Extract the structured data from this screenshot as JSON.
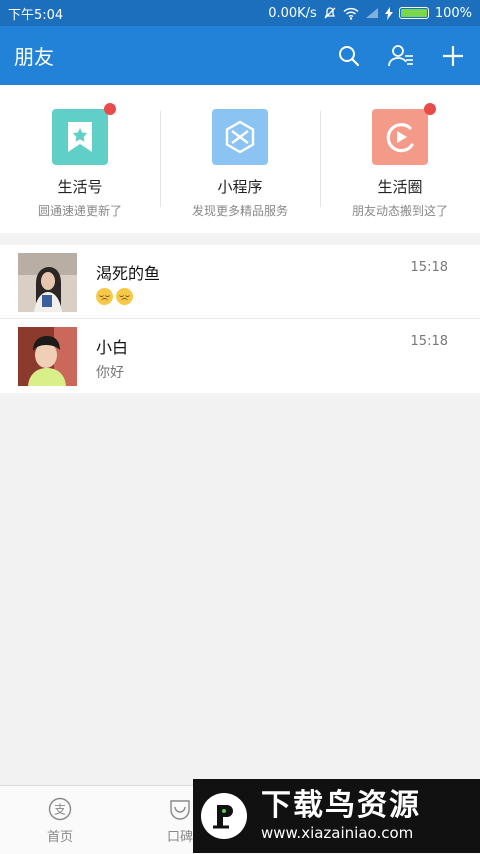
{
  "statusbar": {
    "time": "下午5:04",
    "speed": "0.00K/s",
    "battery": "100%"
  },
  "header": {
    "title": "朋友",
    "icons": [
      "search-icon",
      "contacts-icon",
      "plus-icon"
    ]
  },
  "quick_entries": [
    {
      "label": "生活号",
      "subtitle": "圆通速递更新了",
      "icon": "bookmark-star-icon",
      "color": "#5fcfc7",
      "has_badge": true
    },
    {
      "label": "小程序",
      "subtitle": "发现更多精品服务",
      "icon": "mini-program-icon",
      "color": "#8bc4f2",
      "has_badge": false
    },
    {
      "label": "生活圈",
      "subtitle": "朋友动态搬到这了",
      "icon": "life-circle-icon",
      "color": "#f49a88",
      "has_badge": true
    }
  ],
  "chats": [
    {
      "name": "渴死的鱼",
      "time": "15:18",
      "message": "😔😔"
    },
    {
      "name": "小白",
      "time": "15:18",
      "message": "你好"
    }
  ],
  "tabbar": {
    "tabs": [
      {
        "label": "首页",
        "icon": "home-icon"
      },
      {
        "label": "口碑",
        "icon": "koubei-icon"
      }
    ]
  },
  "watermark": {
    "text": "下载鸟资源",
    "url": "www.xiazainiao.com"
  },
  "colors": {
    "header": "#2182d8",
    "statusbar": "#1b6fbd",
    "badge": "#e94b4b"
  }
}
